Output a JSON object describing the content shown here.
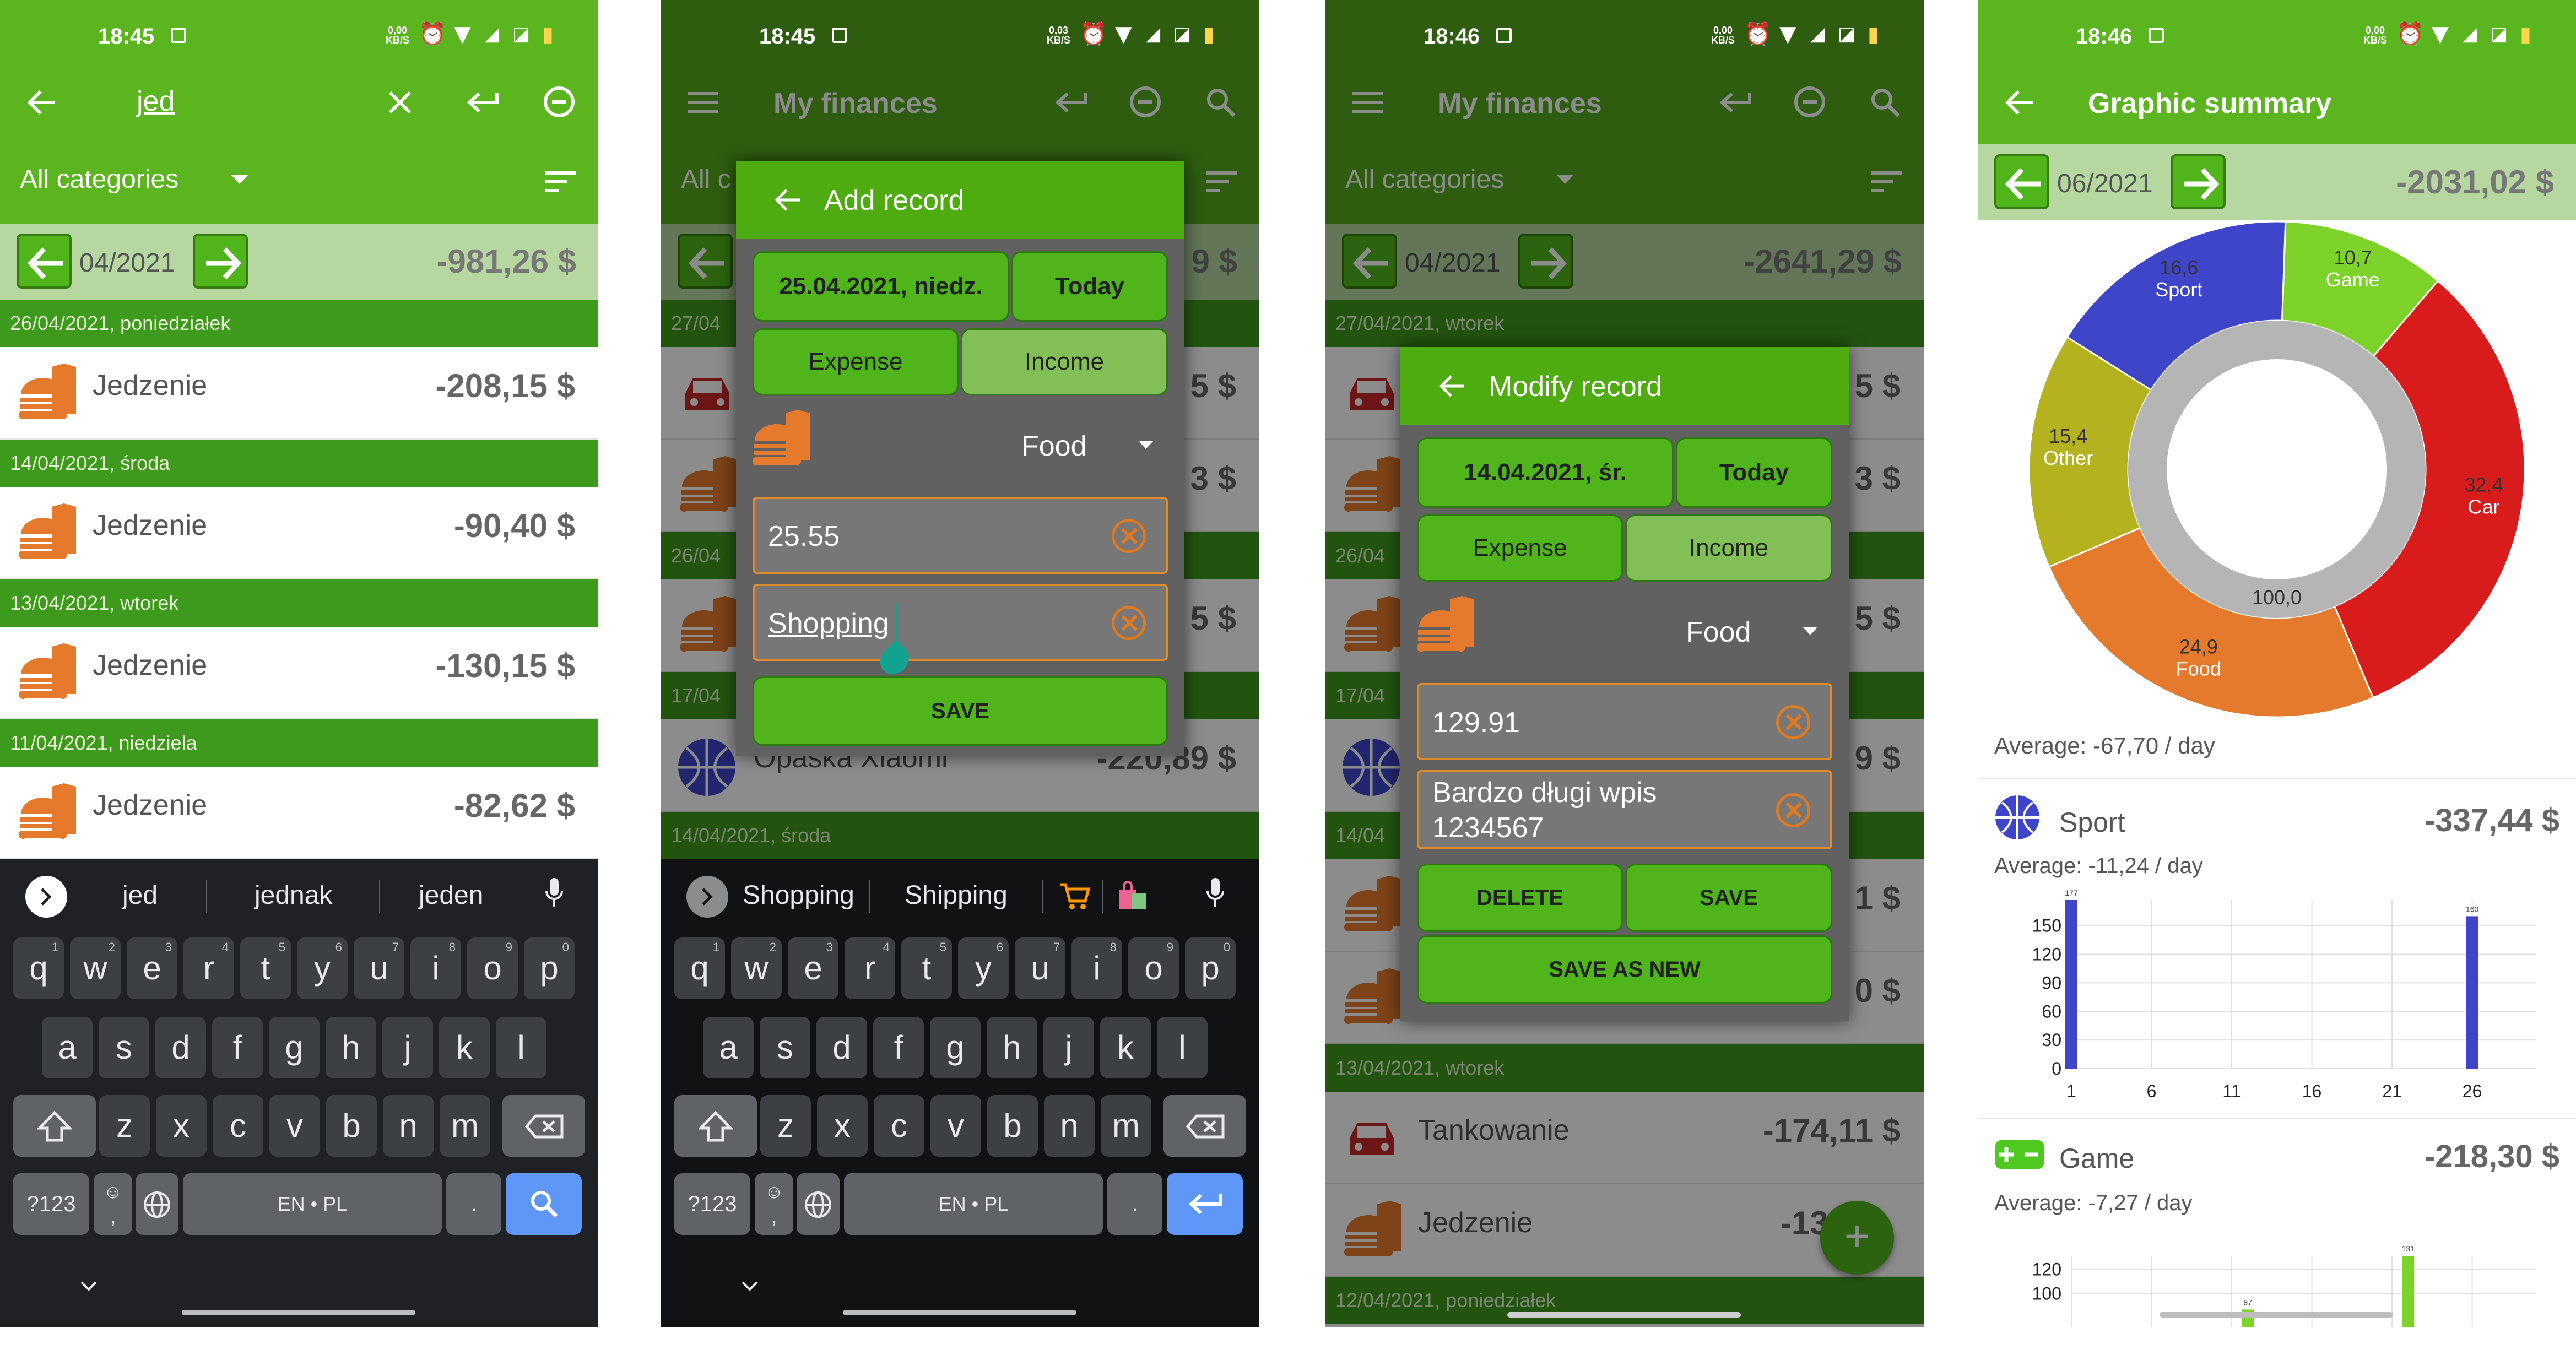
{
  "status": {
    "time1": "18:45",
    "time2": "18:45",
    "time3": "18:46",
    "time4": "18:46",
    "net1_top": "0,00",
    "net1_bot": "KB/S",
    "net2_top": "0,03",
    "net2_bot": "KB/S",
    "net3_top": "0,00",
    "net3_bot": "KB/S",
    "net4_top": "0,00",
    "net4_bot": "KB/S"
  },
  "screen1": {
    "search_query": "jed",
    "category_filter": "All categories",
    "period": "04/2021",
    "period_total": "-981,26 $",
    "days": [
      {
        "header": "26/04/2021, poniedziałek",
        "label": "Jedzenie",
        "amount": "-208,15 $"
      },
      {
        "header": "14/04/2021, środa",
        "label": "Jedzenie",
        "amount": "-90,40 $"
      },
      {
        "header": "13/04/2021, wtorek",
        "label": "Jedzenie",
        "amount": "-130,15 $"
      },
      {
        "header": "11/04/2021, niedziela",
        "label": "Jedzenie",
        "amount": "-82,62 $"
      }
    ],
    "suggestions": [
      "jed",
      "jednak",
      "jeden"
    ]
  },
  "keyboard": {
    "row1": [
      "q",
      "w",
      "e",
      "r",
      "t",
      "y",
      "u",
      "i",
      "o",
      "p"
    ],
    "row1_nums": [
      "1",
      "2",
      "3",
      "4",
      "5",
      "6",
      "7",
      "8",
      "9",
      "0"
    ],
    "row2": [
      "a",
      "s",
      "d",
      "f",
      "g",
      "h",
      "j",
      "k",
      "l"
    ],
    "row3": [
      "z",
      "x",
      "c",
      "v",
      "b",
      "n",
      "m"
    ],
    "sym": "?123",
    "emoji": "☺",
    "comma": ",",
    "space": "EN • PL",
    "dot": "."
  },
  "screen2": {
    "title": "My finances",
    "bg_filter": "All c",
    "bg_rows": [
      {
        "header": "27/04",
        "amount": "5 $"
      },
      {
        "amount": "3 $"
      },
      {
        "header": "26/04",
        "amount": "5 $"
      },
      {
        "header": "17/04",
        "label": "Opaska Xiaomi",
        "amount": "-220,89 $"
      },
      {
        "header": "14/04/2021, środa"
      }
    ],
    "bg_total": "9 $",
    "dialog": {
      "title": "Add record",
      "date": "25.04.2021, niedz.",
      "today": "Today",
      "expense": "Expense",
      "income": "Income",
      "category": "Food",
      "amount": "25.55",
      "note": "Shopping",
      "save": "SAVE"
    },
    "suggestions": [
      "Shopping",
      "Shipping"
    ]
  },
  "screen3": {
    "title": "My finances",
    "filter": "All categories",
    "period": "04/2021",
    "period_total": "-2641,29 $",
    "bg_headers": [
      "27/04/2021, wtorek",
      "26/04",
      "17/04",
      "14/04",
      "13/04/2021, wtorek",
      "12/04/2021, poniedziałek"
    ],
    "bg_amounts": [
      "5 $",
      "3 $",
      "5 $",
      "9 $",
      "1 $",
      "0 $"
    ],
    "row_a_label": "Tankowanie",
    "row_a_amount": "-174,11 $",
    "row_b_label": "Jedzenie",
    "row_b_amount": "-130",
    "dialog": {
      "title": "Modify record",
      "date": "14.04.2021, śr.",
      "today": "Today",
      "expense": "Expense",
      "income": "Income",
      "category": "Food",
      "amount": "129.91",
      "note_line1": "Bardzo długi wpis",
      "note_line2": "1234567",
      "delete": "DELETE",
      "save": "SAVE",
      "save_new": "SAVE AS NEW"
    },
    "fab": "+"
  },
  "screen4": {
    "title": "Graphic summary",
    "period": "06/2021",
    "period_total": "-2031,02 $",
    "donut_center": "100,0",
    "average": "Average: -67,70 / day",
    "sport": {
      "name": "Sport",
      "total": "-337,44 $",
      "average": "Average: -11,24 / day"
    },
    "game": {
      "name": "Game",
      "total": "-218,30 $",
      "average": "Average: -7,27 / day"
    }
  },
  "chart_data": [
    {
      "type": "pie",
      "labels": [
        "Game",
        "Car",
        "Food",
        "Other",
        "Sport"
      ],
      "values": [
        10.7,
        32.4,
        24.9,
        15.4,
        16.6
      ],
      "value_labels": [
        "10,7",
        "32,4",
        "24,9",
        "15,4",
        "16,6"
      ],
      "colors": [
        "#7dd32a",
        "#d81b1b",
        "#e67a2c",
        "#b4b21e",
        "#3e45c9"
      ],
      "center_label": "100,0"
    },
    {
      "type": "bar",
      "title": "Sport",
      "x_ticks": [
        1,
        6,
        11,
        16,
        21,
        26
      ],
      "y_ticks": [
        0,
        30,
        60,
        90,
        120,
        150
      ],
      "ylim": [
        0,
        177
      ],
      "xlim": [
        1,
        30
      ],
      "points": [
        {
          "x": 1,
          "y": 177,
          "label": "177"
        },
        {
          "x": 26,
          "y": 160,
          "label": "160"
        }
      ],
      "color": "#3e45c9"
    },
    {
      "type": "bar",
      "title": "Game",
      "y_ticks": [
        100,
        120
      ],
      "ylim": [
        0,
        131
      ],
      "xlim": [
        1,
        30
      ],
      "points": [
        {
          "x": 12,
          "y": 87,
          "label": "87"
        },
        {
          "x": 22,
          "y": 131,
          "label": "131"
        }
      ],
      "color": "#7dd32a"
    }
  ]
}
